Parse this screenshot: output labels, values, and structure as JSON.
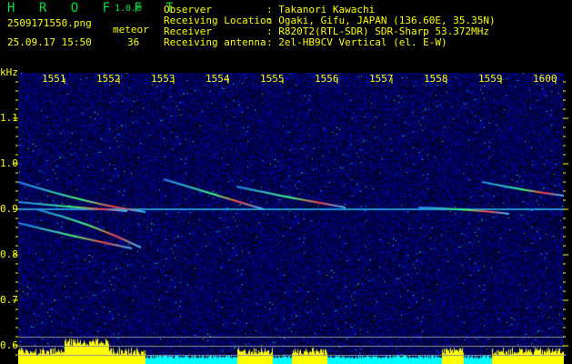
{
  "header": {
    "app": "H R O F F T",
    "version": "1.0.0",
    "filename": "2509171550.png",
    "datetime": "25.09.17 15:50",
    "meteor_label": "meteor",
    "meteor_count": "36"
  },
  "info": [
    {
      "label": "Observer",
      "value": ": Takanori Kawachi"
    },
    {
      "label": "Receiving Location",
      "value": ": Ogaki, Gifu, JAPAN (136.60E, 35.35N)"
    },
    {
      "label": "Receiver",
      "value": ": R820T2(RTL-SDR) SDR-Sharp 53.372MHz"
    },
    {
      "label": "Receiving antenna",
      "value": ": 2el-HB9CV Vertical (el. E-W)"
    }
  ],
  "chart_data": {
    "type": "heatmap",
    "ylabel": "kHz",
    "xticks": [
      "1551",
      "1552",
      "1553",
      "1554",
      "1555",
      "1556",
      "1557",
      "1558",
      "1559",
      "1600"
    ],
    "yticks": [
      "1.1",
      "1.0",
      "0.9",
      "0.8",
      "0.7",
      "0.6"
    ],
    "ylim": [
      0.57,
      1.2
    ],
    "carrier_khz": 0.9,
    "colors": {
      "background": "#000000",
      "noise": "#1020c0",
      "text": "#ffff00",
      "title": "#00e040",
      "level_high": "#ffff00",
      "level_low": "#00ffff"
    }
  }
}
